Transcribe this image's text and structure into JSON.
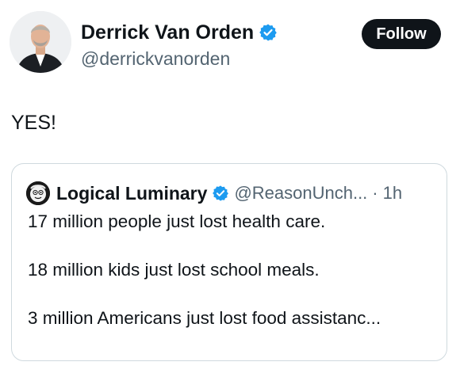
{
  "author": {
    "display_name": "Derrick Van Orden",
    "handle": "@derrickvanorden",
    "verified": true,
    "avatar_icon": "profile-photo-man-in-suit"
  },
  "follow_button": {
    "label": "Follow"
  },
  "tweet": {
    "text": "YES!"
  },
  "quoted_tweet": {
    "display_name": "Logical Luminary",
    "handle": "@ReasonUnch...",
    "separator": "·",
    "time": "1h",
    "verified": true,
    "avatar_icon": "cartoon-avatar",
    "paragraphs": [
      "17 million people just lost health care.",
      "18 million kids just lost school meals.",
      "3 million Americans just lost food assistanc..."
    ]
  },
  "colors": {
    "text_primary": "#0f1419",
    "text_secondary": "#536471",
    "verified_blue": "#1d9bf0",
    "follow_bg": "#0f1419",
    "border": "#cfd9de"
  }
}
